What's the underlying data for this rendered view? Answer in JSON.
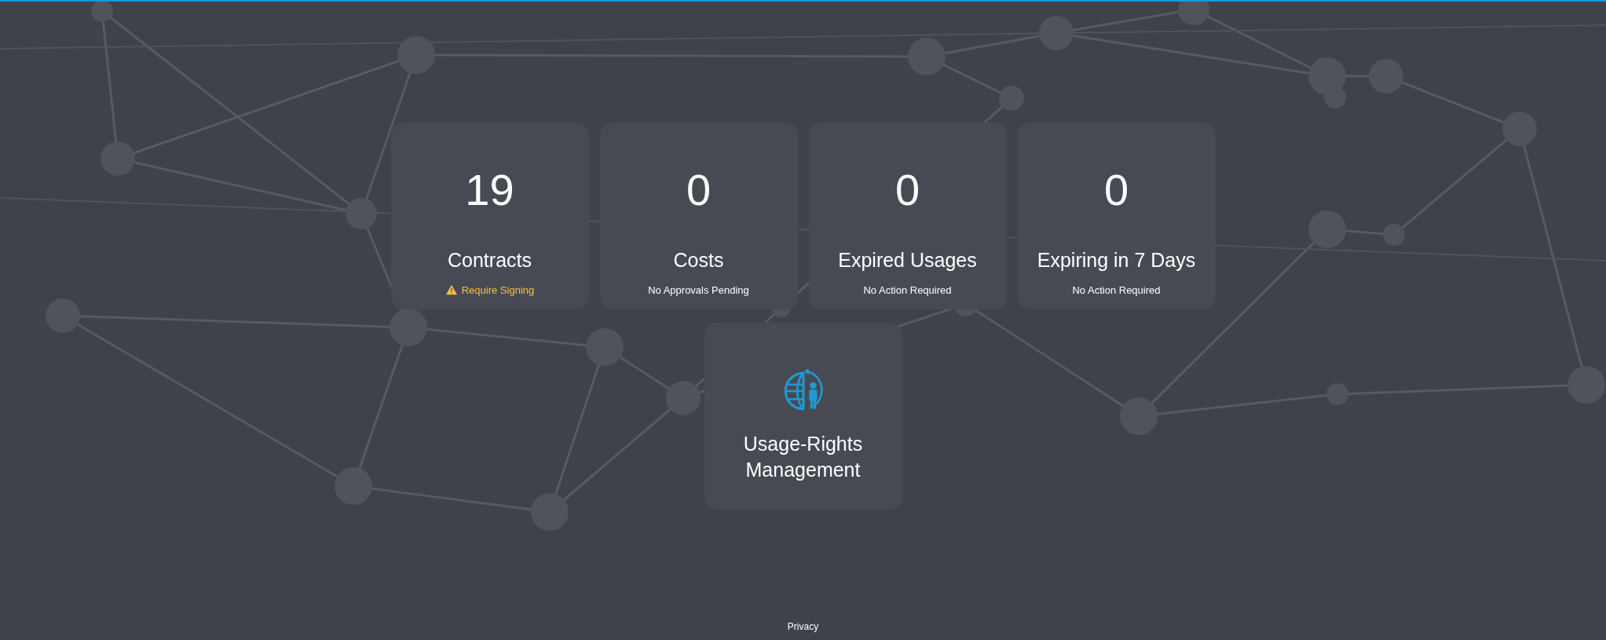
{
  "stats": [
    {
      "value": "19",
      "title": "Contracts",
      "status": "Require Signing",
      "warning": true
    },
    {
      "value": "0",
      "title": "Costs",
      "status": "No Approvals Pending",
      "warning": false
    },
    {
      "value": "0",
      "title": "Expired Usages",
      "status": "No Action Required",
      "warning": false
    },
    {
      "value": "0",
      "title": "Expiring in 7 Days",
      "status": "No Action Required",
      "warning": false
    }
  ],
  "apps": [
    {
      "title": "Usage-Rights Management"
    }
  ],
  "footer": {
    "link": "Privacy"
  }
}
